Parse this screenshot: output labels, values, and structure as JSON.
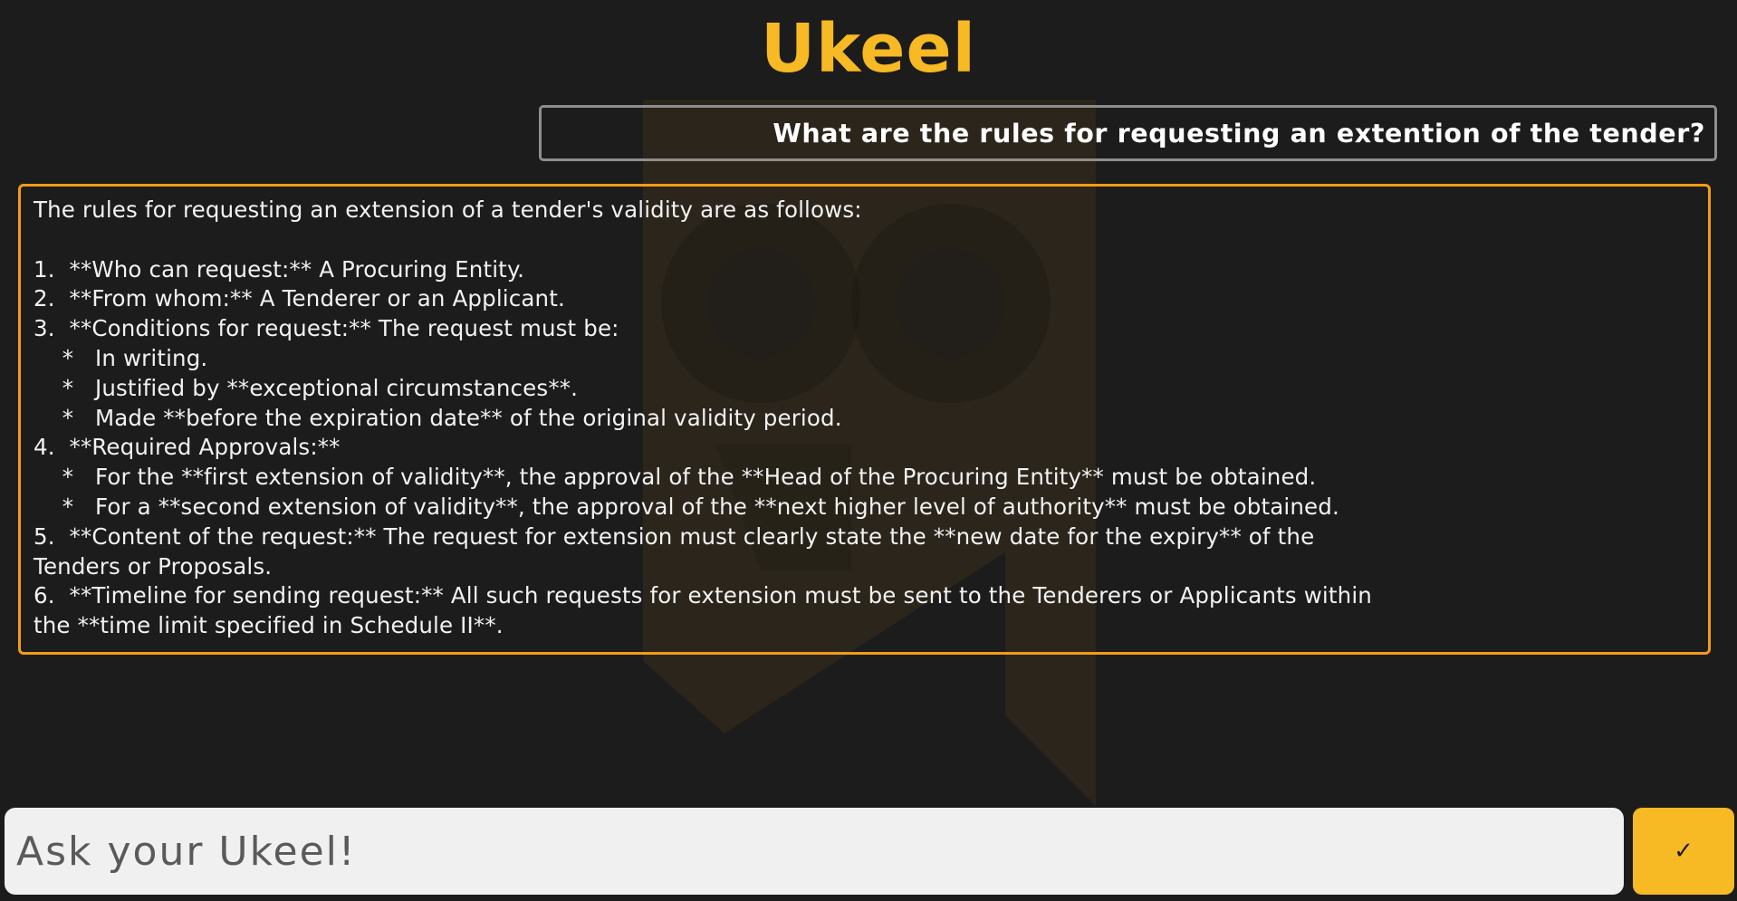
{
  "app": {
    "title": "Ukeel"
  },
  "chat": {
    "question": "What are the rules for requesting an extention of the tender?",
    "answer_lines": [
      "The rules for requesting an extension of a tender's validity are as follows:",
      "",
      "1.  **Who can request:** A Procuring Entity.",
      "2.  **From whom:** A Tenderer or an Applicant.",
      "3.  **Conditions for request:** The request must be:",
      "    *   In writing.",
      "    *   Justified by **exceptional circumstances**.",
      "    *   Made **before the expiration date** of the original validity period.",
      "4.  **Required Approvals:**",
      "    *   For the **first extension of validity**, the approval of the **Head of the Procuring Entity** must be obtained.",
      "    *   For a **second extension of validity**, the approval of the **next higher level of authority** must be obtained.",
      "5.  **Content of the request:** The request for extension must clearly state the **new date for the expiry** of the",
      "Tenders or Proposals.",
      "6.  **Timeline for sending request:** All such requests for extension must be sent to the Tenderers or Applicants within",
      "the **time limit specified in Schedule II**."
    ]
  },
  "input": {
    "placeholder": "Ask your Ukeel!",
    "value": ""
  },
  "send_button": {
    "icon_glyph": "✓",
    "icon": "checkmark-icon"
  },
  "colors": {
    "background": "#1c1c1c",
    "accent": "#f7b924",
    "answer_border": "#f39c12",
    "question_border": "#8e8e8e"
  }
}
